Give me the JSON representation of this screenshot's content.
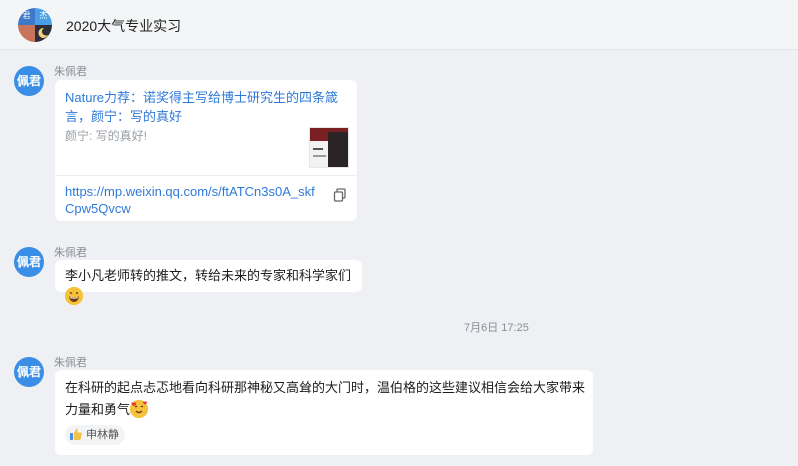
{
  "header": {
    "title": "2020大气专业实习",
    "avatar_chars": [
      "君",
      "杰",
      "",
      ""
    ]
  },
  "messages": [
    {
      "avatar_text": "佩君",
      "sender": "朱佩君",
      "link_card": {
        "title": "Nature力荐：诺奖得主写给博士研究生的四条箴言，颜宁：写的真好",
        "description": "颜宁: 写的真好!",
        "url": "https://mp.weixin.qq.com/s/ftATCn3s0A_skfCpw5Qvcw"
      }
    },
    {
      "avatar_text": "佩君",
      "sender": "朱佩君",
      "text": "李小凡老师转的推文，转给未来的专家和科学家们",
      "emoji": "grinning-face"
    },
    {
      "avatar_text": "佩君",
      "sender": "朱佩君",
      "text": "在科研的起点忐忑地看向科研那神秘又高耸的大门时，温伯格的这些建议相信会给大家带来力量和勇气",
      "emoji": "smiling-face-with-hearts",
      "reaction": {
        "icon": "thumbs-up-icon",
        "user": "申林静"
      }
    }
  ],
  "timestamp": "7月6日 17:25",
  "colors": {
    "background": "#eef0f3",
    "avatar": "#3b8ee6",
    "link": "#2f7ad8"
  }
}
